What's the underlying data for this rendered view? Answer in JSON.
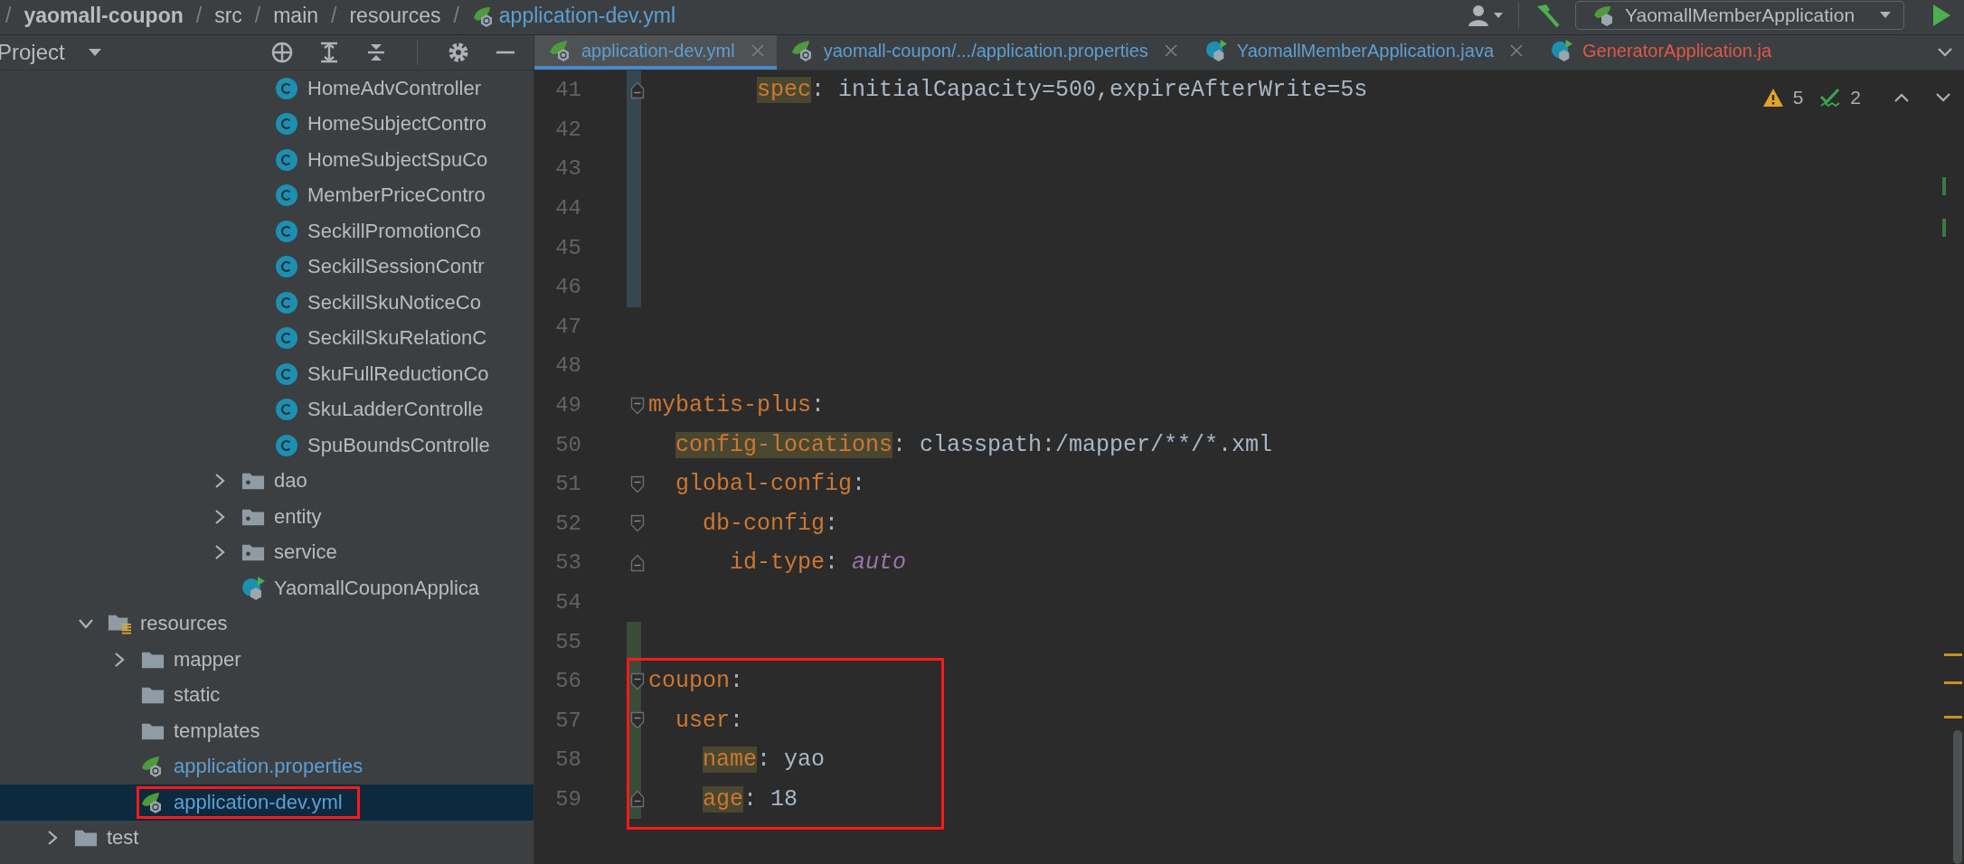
{
  "breadcrumb": [
    {
      "text": "/",
      "kind": "separator"
    },
    {
      "text": "yaomall-coupon",
      "kind": "module"
    },
    {
      "text": "/",
      "kind": "separator"
    },
    {
      "text": "src",
      "kind": "folder"
    },
    {
      "text": "/",
      "kind": "separator"
    },
    {
      "text": "main",
      "kind": "folder"
    },
    {
      "text": "/",
      "kind": "separator"
    },
    {
      "text": "resources",
      "kind": "folder"
    },
    {
      "text": "/",
      "kind": "separator"
    },
    {
      "text": "application-dev.yml",
      "kind": "spring-file"
    }
  ],
  "toolbar": {
    "run_config": "YaomallMemberApplication"
  },
  "project_panel": {
    "title": "Project",
    "tree": [
      {
        "children": [
          {
            "children": [
              {
                "children": [
                  {
                    "children": [
                      {
                        "children": [
                          {
                            "children": [
                              {
                                "name": "HomeAdvController",
                                "kind": "class",
                                "selected": false,
                                "boxed": false
                              },
                              {
                                "name": "HomeSubjectContro",
                                "kind": "class",
                                "selected": false,
                                "boxed": false
                              },
                              {
                                "name": "HomeSubjectSpuCo",
                                "kind": "class",
                                "selected": false,
                                "boxed": false
                              },
                              {
                                "name": "MemberPriceContro",
                                "kind": "class",
                                "selected": false,
                                "boxed": false
                              },
                              {
                                "name": "SeckillPromotionCo",
                                "kind": "class",
                                "selected": false,
                                "boxed": false
                              },
                              {
                                "name": "SeckillSessionContr",
                                "kind": "class",
                                "selected": false,
                                "boxed": false
                              },
                              {
                                "name": "SeckillSkuNoticeCo",
                                "kind": "class",
                                "selected": false,
                                "boxed": false
                              },
                              {
                                "name": "SeckillSkuRelationC",
                                "kind": "class",
                                "selected": false,
                                "boxed": false
                              },
                              {
                                "name": "SkuFullReductionCo",
                                "kind": "class",
                                "selected": false,
                                "boxed": false
                              },
                              {
                                "name": "SkuLadderControlle",
                                "kind": "class",
                                "selected": false,
                                "boxed": false
                              },
                              {
                                "name": "SpuBoundsControlle",
                                "kind": "class",
                                "selected": false,
                                "boxed": false
                              }
                            ]
                          },
                          {
                            "name": "dao",
                            "kind": "package",
                            "expanded": false,
                            "selected": false,
                            "boxed": false
                          },
                          {
                            "name": "entity",
                            "kind": "package",
                            "expanded": false,
                            "selected": false,
                            "boxed": false
                          },
                          {
                            "name": "service",
                            "kind": "package",
                            "expanded": false,
                            "selected": false,
                            "boxed": false
                          },
                          {
                            "name": "YaomallCouponApplica",
                            "kind": "spring-app",
                            "selected": false,
                            "boxed": false
                          }
                        ]
                      }
                    ]
                  }
                ]
              }
            ]
          },
          {
            "name": "resources",
            "kind": "resources",
            "expanded": true,
            "selected": false,
            "boxed": false,
            "children": [
              {
                "name": "mapper",
                "kind": "folder",
                "expanded": false,
                "selected": false,
                "boxed": false
              },
              {
                "name": "static",
                "kind": "folder",
                "selected": false,
                "boxed": false
              },
              {
                "name": "templates",
                "kind": "folder",
                "selected": false,
                "boxed": false
              },
              {
                "name": "application.properties",
                "kind": "spring-file",
                "selected": false,
                "boxed": false
              },
              {
                "name": "application-dev.yml",
                "kind": "spring-file",
                "selected": true,
                "boxed": true
              }
            ]
          }
        ]
      },
      {
        "name": "test",
        "kind": "folder",
        "expanded": false,
        "selected": false,
        "boxed": false
      }
    ]
  },
  "tabs": [
    {
      "label": "application-dev.yml",
      "kind": "spring-file",
      "color": "#5e9fd3",
      "selected": true,
      "closable": true
    },
    {
      "label": "yaomall-coupon/.../application.properties",
      "kind": "spring-file",
      "color": "#5e9fd3",
      "selected": false,
      "closable": true
    },
    {
      "label": "YaomallMemberApplication.java",
      "kind": "spring-app",
      "color": "#5e9fd3",
      "selected": false,
      "closable": true
    },
    {
      "label": "GeneratorApplication.ja",
      "kind": "spring-app",
      "color": "#e0574a",
      "selected": false,
      "closable": false
    }
  ],
  "editor": {
    "inspections": {
      "warnings": "5",
      "checks": "2"
    },
    "lines": [
      {
        "children": [
          {
            "children": [
              {
                "children": [
                  {
                    "children": [
                      {
                        "number": "41",
                        "fold_start": false,
                        "fold_end": true,
                        "modified": true,
                        "added": false,
                        "boxed": false,
                        "tokens": [
                          {
                            "kind": "key",
                            "text": "spec",
                            "highlighted": true
                          },
                          {
                            "kind": "punct",
                            "text": ": "
                          },
                          {
                            "kind": "text",
                            "text": "initialCapacity=500,expireAfterWrite=5s"
                          }
                        ]
                      }
                    ]
                  }
                ]
              }
            ]
          }
        ]
      },
      {
        "number": "42",
        "fold_start": false,
        "fold_end": false,
        "modified": true,
        "added": false,
        "boxed": false
      },
      {
        "number": "43",
        "fold_start": false,
        "fold_end": false,
        "modified": true,
        "added": false,
        "boxed": false
      },
      {
        "number": "44",
        "fold_start": false,
        "fold_end": false,
        "modified": true,
        "added": false,
        "boxed": false
      },
      {
        "number": "45",
        "fold_start": false,
        "fold_end": false,
        "modified": true,
        "added": false,
        "boxed": false
      },
      {
        "number": "46",
        "fold_start": false,
        "fold_end": false,
        "modified": true,
        "added": false,
        "boxed": false
      },
      {
        "number": "47",
        "fold_start": false,
        "fold_end": false,
        "modified": false,
        "added": false,
        "boxed": false
      },
      {
        "number": "48",
        "fold_start": false,
        "fold_end": false,
        "modified": false,
        "added": false,
        "boxed": false
      },
      {
        "number": "49",
        "fold_start": true,
        "fold_end": false,
        "modified": false,
        "added": false,
        "boxed": false,
        "tokens": [
          {
            "kind": "key",
            "text": "mybatis-plus",
            "highlighted": false
          },
          {
            "kind": "punct",
            "text": ":"
          }
        ],
        "children": [
          {
            "number": "50",
            "fold_start": false,
            "fold_end": false,
            "modified": false,
            "added": false,
            "boxed": false,
            "tokens": [
              {
                "kind": "key",
                "text": "config-locations",
                "highlighted": true
              },
              {
                "kind": "punct",
                "text": ": "
              },
              {
                "kind": "text",
                "text": "classpath:/mapper/**/*.xml"
              }
            ]
          },
          {
            "number": "51",
            "fold_start": true,
            "fold_end": false,
            "modified": false,
            "added": false,
            "boxed": false,
            "tokens": [
              {
                "kind": "key",
                "text": "global-config",
                "highlighted": false
              },
              {
                "kind": "punct",
                "text": ":"
              }
            ],
            "children": [
              {
                "number": "52",
                "fold_start": true,
                "fold_end": false,
                "modified": false,
                "added": false,
                "boxed": false,
                "tokens": [
                  {
                    "kind": "key",
                    "text": "db-config",
                    "highlighted": false
                  },
                  {
                    "kind": "punct",
                    "text": ":"
                  }
                ],
                "children": [
                  {
                    "number": "53",
                    "fold_start": false,
                    "fold_end": true,
                    "modified": false,
                    "added": false,
                    "boxed": false,
                    "tokens": [
                      {
                        "kind": "key",
                        "text": "id-type",
                        "highlighted": false
                      },
                      {
                        "kind": "punct",
                        "text": ": "
                      },
                      {
                        "kind": "constant",
                        "text": "auto"
                      }
                    ]
                  }
                ]
              }
            ]
          }
        ]
      },
      {
        "number": "54",
        "fold_start": false,
        "fold_end": false,
        "modified": false,
        "added": false,
        "boxed": false
      },
      {
        "number": "55",
        "fold_start": false,
        "fold_end": false,
        "modified": false,
        "added": true,
        "boxed": false
      },
      {
        "number": "56",
        "fold_start": true,
        "fold_end": false,
        "modified": false,
        "added": true,
        "boxed": true,
        "tokens": [
          {
            "kind": "key",
            "text": "coupon",
            "highlighted": false
          },
          {
            "kind": "punct",
            "text": ":"
          }
        ],
        "children": [
          {
            "number": "57",
            "fold_start": true,
            "fold_end": false,
            "modified": false,
            "added": true,
            "boxed": true,
            "tokens": [
              {
                "kind": "key",
                "text": "user",
                "highlighted": false
              },
              {
                "kind": "punct",
                "text": ":"
              }
            ],
            "children": [
              {
                "number": "58",
                "fold_start": false,
                "fold_end": false,
                "modified": false,
                "added": true,
                "boxed": true,
                "tokens": [
                  {
                    "kind": "key",
                    "text": "name",
                    "highlighted": true
                  },
                  {
                    "kind": "punct",
                    "text": ": "
                  },
                  {
                    "kind": "text",
                    "text": "yao"
                  }
                ]
              },
              {
                "number": "59",
                "fold_start": false,
                "fold_end": true,
                "modified": false,
                "added": true,
                "boxed": true,
                "tokens": [
                  {
                    "kind": "key",
                    "text": "age",
                    "highlighted": true
                  },
                  {
                    "kind": "punct",
                    "text": ": "
                  },
                  {
                    "kind": "text",
                    "text": "18"
                  }
                ]
              }
            ]
          }
        ]
      }
    ]
  }
}
